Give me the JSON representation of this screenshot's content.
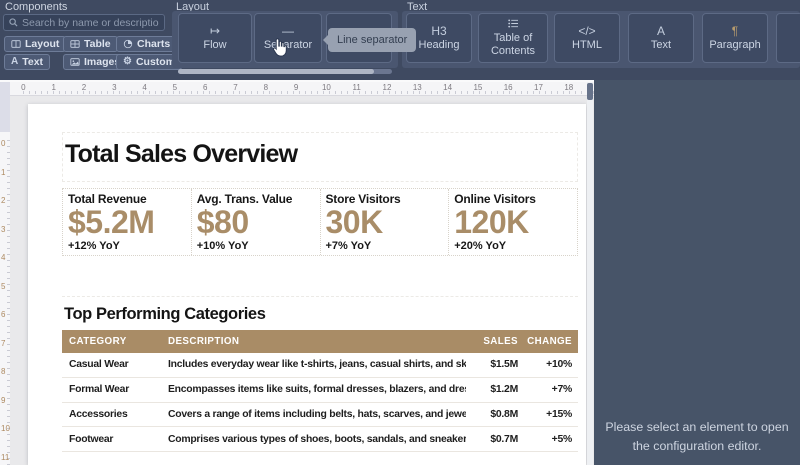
{
  "toolbar": {
    "components": {
      "title": "Components",
      "search_placeholder": "Search by name or description",
      "buttons": [
        {
          "label": "Layout",
          "icon": "layout-icon"
        },
        {
          "label": "Table",
          "icon": "table-icon"
        },
        {
          "label": "Charts",
          "icon": "charts-icon"
        },
        {
          "label": "Text",
          "icon": "text-icon",
          "glyph": "A"
        },
        {
          "label": "Images",
          "icon": "images-icon"
        },
        {
          "label": "Custom",
          "icon": "custom-icon",
          "glyph": "⚙"
        }
      ]
    },
    "layout_section": {
      "title": "Layout",
      "items": [
        {
          "label": "Flow",
          "glyph": "↦"
        },
        {
          "label": "Separator",
          "glyph": "—"
        }
      ]
    },
    "tooltip": "Line separator",
    "text_section": {
      "title": "Text",
      "items": [
        {
          "label": "Heading",
          "glyph": "H3"
        },
        {
          "label": "Table of Contents",
          "icon": "list-icon"
        },
        {
          "label": "HTML",
          "glyph": "</>"
        },
        {
          "label": "Text",
          "glyph": "A"
        },
        {
          "label": "Paragraph",
          "glyph": "¶"
        }
      ]
    }
  },
  "rulers": {
    "horizontal": [
      "0",
      "1",
      "2",
      "3",
      "4",
      "5",
      "6",
      "7",
      "8",
      "9",
      "10",
      "11",
      "12",
      "13",
      "14",
      "15",
      "16",
      "17",
      "18"
    ],
    "vertical": [
      "0",
      "1",
      "2",
      "3",
      "4",
      "5",
      "6",
      "7",
      "8",
      "9",
      "10",
      "11"
    ]
  },
  "document": {
    "title": "Total Sales Overview",
    "kpis": [
      {
        "label": "Total Revenue",
        "value": "$5.2M",
        "change": "+12% YoY"
      },
      {
        "label": "Avg. Trans. Value",
        "value": "$80",
        "change": "+10% YoY"
      },
      {
        "label": "Store Visitors",
        "value": "30K",
        "change": "+7% YoY"
      },
      {
        "label": "Online Visitors",
        "value": "120K",
        "change": "+20% YoY"
      }
    ],
    "categories_title": "Top Performing Categories",
    "table": {
      "columns": [
        "CATEGORY",
        "DESCRIPTION",
        "SALES",
        "CHANGE"
      ],
      "rows": [
        {
          "category": "Casual Wear",
          "description": "Includes everyday wear like t-shirts, jeans, casual shirts, and skirts",
          "sales": "$1.5M",
          "change": "+10%"
        },
        {
          "category": "Formal Wear",
          "description": "Encompasses items like suits, formal dresses, blazers, and dress shirts",
          "sales": "$1.2M",
          "change": "+7%"
        },
        {
          "category": "Accessories",
          "description": "Covers a range of items including belts, hats, scarves, and jewelry",
          "sales": "$0.8M",
          "change": "+15%"
        },
        {
          "category": "Footwear",
          "description": "Comprises various types of shoes, boots, sandals, and sneakers",
          "sales": "$0.7M",
          "change": "+5%"
        }
      ]
    }
  },
  "inspector": {
    "message": "Please select an element to open the configuration editor."
  },
  "colors": {
    "accent": "#a98c66",
    "toolbar_bg": "#3f4a61",
    "inspector_bg": "#475468"
  }
}
